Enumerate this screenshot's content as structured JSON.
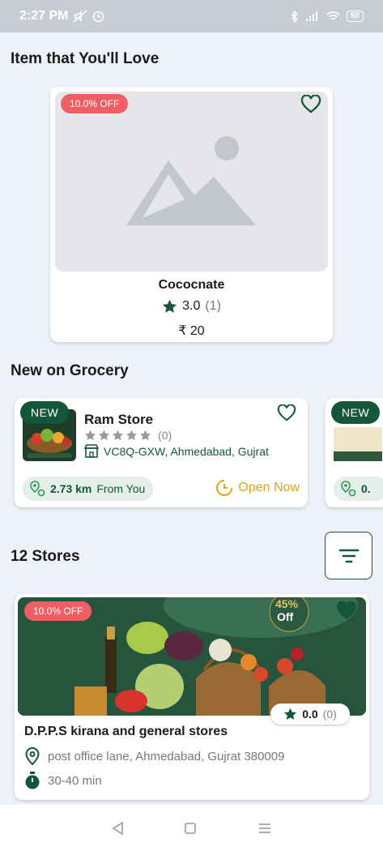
{
  "status_bar": {
    "time": "2:27 PM",
    "battery": "68"
  },
  "section_love": {
    "title": "Item that You'll Love"
  },
  "product": {
    "discount": "10.0% OFF",
    "name": "Cococnate",
    "rating": "3.0",
    "rating_count": "(1)",
    "price": "₹ 20"
  },
  "section_new": {
    "title": "New on Grocery"
  },
  "new_stores": [
    {
      "badge": "NEW",
      "name": "Ram Store",
      "rating_count": "(0)",
      "address": "VC8Q-GXW, Ahmedabad, Gujrat",
      "distance": "2.73 km",
      "distance_suffix": "From You",
      "status": "Open Now"
    },
    {
      "badge": "NEW",
      "distance": "0."
    }
  ],
  "stores_section": {
    "title": "12 Stores"
  },
  "store": {
    "discount": "10.0% OFF",
    "banner_text_top": "45%",
    "banner_text_bottom": "Off",
    "rating": "0.0",
    "rating_count": "(0)",
    "name": "D.P.P.S kirana and general stores",
    "address": "post office lane, Ahmedabad, Gujrat 380009",
    "delivery_time": "30-40 min"
  },
  "colors": {
    "primary": "#14563a",
    "discount": "#f05e63",
    "open": "#e2a21a",
    "background": "#eef1f8"
  },
  "icons": [
    "wifi-icon",
    "signal-icon",
    "bluetooth-icon",
    "heart-icon",
    "star-icon",
    "store-icon",
    "location-icon",
    "clock-icon",
    "filter-icon",
    "timer-icon"
  ]
}
